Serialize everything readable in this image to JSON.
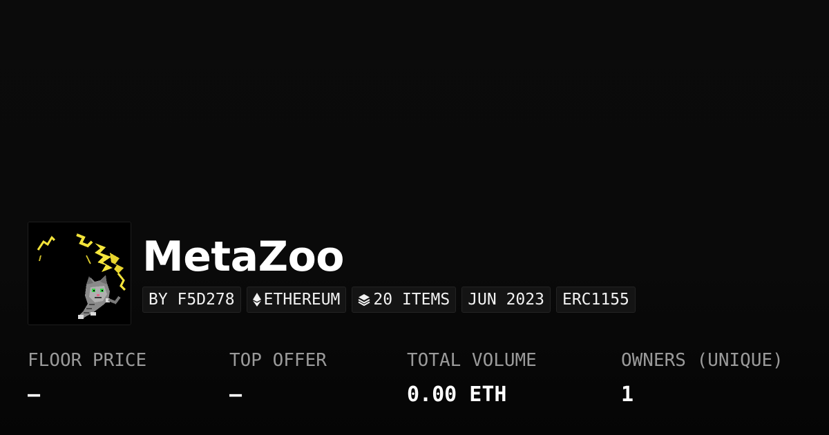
{
  "collection": {
    "name": "MetaZoo",
    "image_alt": "pixel-art-cat-with-lightning"
  },
  "tags": {
    "creator": "BY F5D278",
    "chain": "ETHEREUM",
    "chain_icon": "ethereum-icon",
    "items": "20 ITEMS",
    "items_icon": "layers-icon",
    "date": "JUN 2023",
    "standard": "ERC1155"
  },
  "stats": {
    "floor_price": {
      "label": "FLOOR PRICE",
      "value": "—"
    },
    "top_offer": {
      "label": "TOP OFFER",
      "value": "—"
    },
    "total_volume": {
      "label": "TOTAL VOLUME",
      "value": "0.00 ETH"
    },
    "owners": {
      "label": "OWNERS (UNIQUE)",
      "value": "1"
    }
  },
  "colors": {
    "background": "#0a0a0a",
    "tag_background": "#141414",
    "label": "#9a9a9a",
    "value": "#ffffff",
    "lightning": "#f2e33a"
  }
}
